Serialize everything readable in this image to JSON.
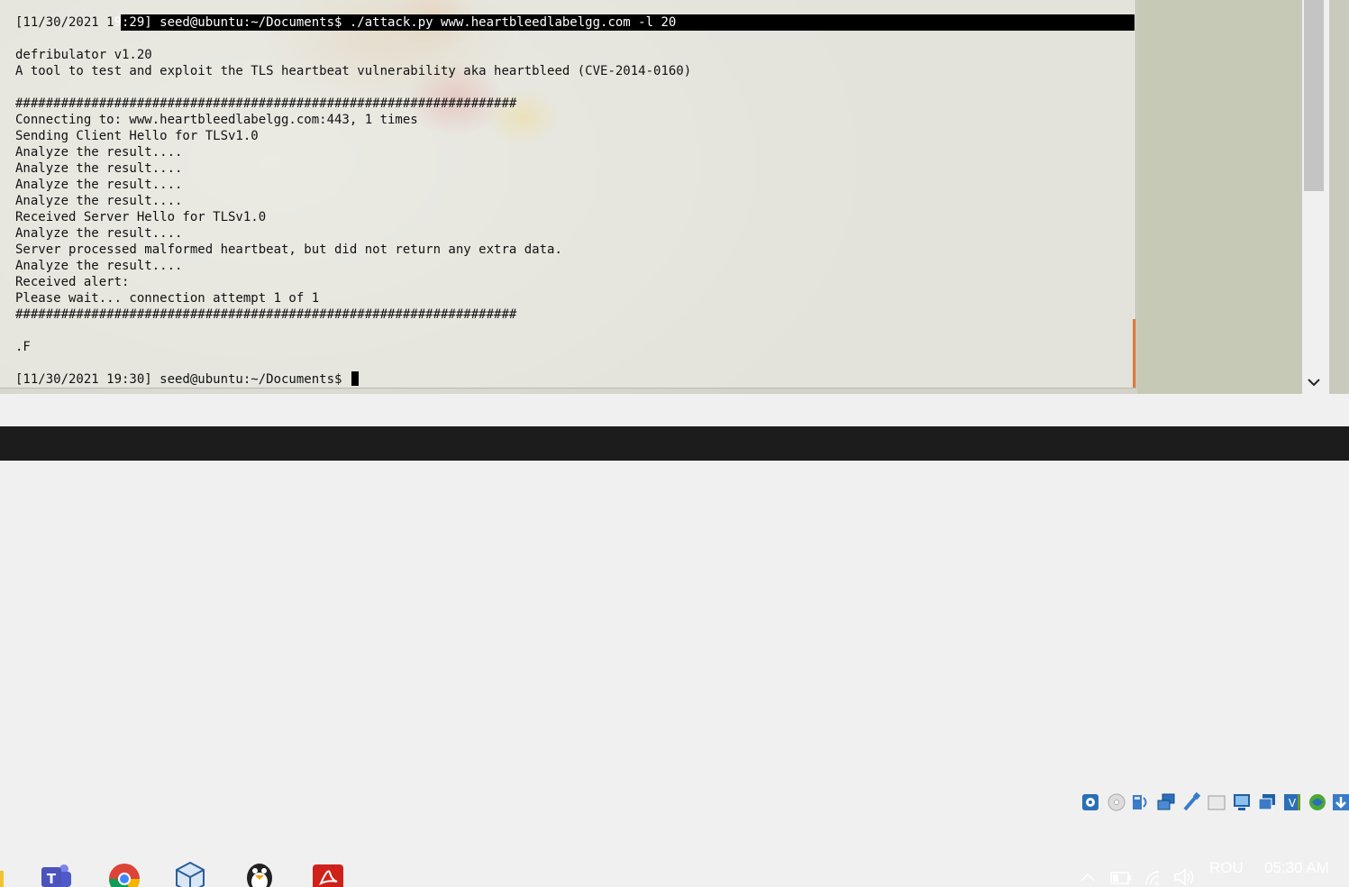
{
  "terminal": {
    "command_prefix": "[11/30/2021 1",
    "command_selected": "9:29] seed@ubuntu:~/Documents$ ./attack.py www.heartbleedlabelgg.com -l 20",
    "lines": [
      "",
      "defribulator v1.20",
      "A tool to test and exploit the TLS heartbeat vulnerability aka heartbleed (CVE-2014-0160)",
      "",
      "##################################################################",
      "Connecting to: www.heartbleedlabelgg.com:443, 1 times",
      "Sending Client Hello for TLSv1.0",
      "Analyze the result....",
      "Analyze the result....",
      "Analyze the result....",
      "Analyze the result....",
      "Received Server Hello for TLSv1.0",
      "Analyze the result....",
      "Server processed malformed heartbeat, but did not return any extra data.",
      "Analyze the result....",
      "Received alert:",
      "Please wait... connection attempt 1 of 1",
      "##################################################################",
      "",
      ".F",
      ""
    ],
    "prompt": "[11/30/2021 19:30] seed@ubuntu:~/Documents$ "
  },
  "statusbar": {
    "icons": [
      "hard-disk-icon",
      "optical-drive-icon",
      "audio-icon",
      "network-icon",
      "usb-icon",
      "shared-folders-icon",
      "display-icon",
      "video-capture-icon",
      "recording-icon",
      "cpu-activity-icon",
      "host-key-icon"
    ]
  },
  "taskbar": {
    "apps": [
      "file-explorer-icon",
      "teams-icon",
      "chrome-icon",
      "virtualbox-icon",
      "linux-penguin-icon",
      "acrobat-reader-icon"
    ],
    "language": "ROU",
    "time": "05:30 AM"
  },
  "colors": {
    "terminal_text": "#111111",
    "selection": "#000000",
    "taskbar": "#1c1c1c",
    "accent_orange": "#e07a3a"
  }
}
